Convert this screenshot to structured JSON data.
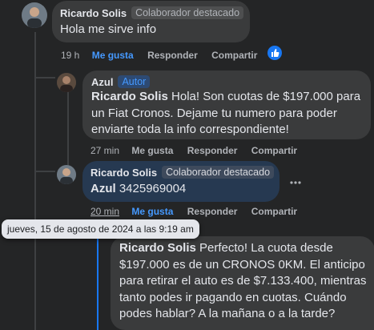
{
  "comments": [
    {
      "author": "Ricardo Solis",
      "badge": "Colaborador destacado",
      "text": "Hola me sirve info",
      "time": "19 h",
      "like": "Me gusta",
      "reply": "Responder",
      "share": "Compartir"
    },
    {
      "author": "Azul",
      "badge": "Autor",
      "mention": "Ricardo Solis",
      "text_line1": " Hola! Son cuotas de $197.000 para",
      "text_line2": "un Fiat Cronos. Dejame tu numero para poder",
      "text_line3": "enviarte toda la info correspondiente!",
      "time": "27 min",
      "like": "Me gusta",
      "reply": "Responder",
      "share": "Compartir"
    },
    {
      "author": "Ricardo Solis",
      "badge": "Colaborador destacado",
      "mention": "Azul",
      "text": " 3425969004",
      "time": "20 min",
      "like": "Me gusta",
      "reply": "Responder",
      "share": "Compartir"
    },
    {
      "mention": "Ricardo Solis",
      "text_line1": " Perfecto! La cuota desde",
      "text_line2": "$197.000 es de un CRONOS 0KM. El anticipo",
      "text_line3": "para retirar el auto es de $7.133.400, mientras",
      "text_line4": "tanto podes ir pagando en cuotas. Cuándo",
      "text_line5": "podes hablar? A la mañana o a la tarde?"
    }
  ],
  "tooltip": "jueves, 15 de agosto de 2024 a las 9:19 am",
  "more_icon": "more-options-icon",
  "like_icon": "thumbs-up-reaction-icon",
  "colors": {
    "background": "#242526",
    "bubble": "#3a3b3c",
    "self_bubble": "#263951",
    "accent": "#4599ff"
  }
}
